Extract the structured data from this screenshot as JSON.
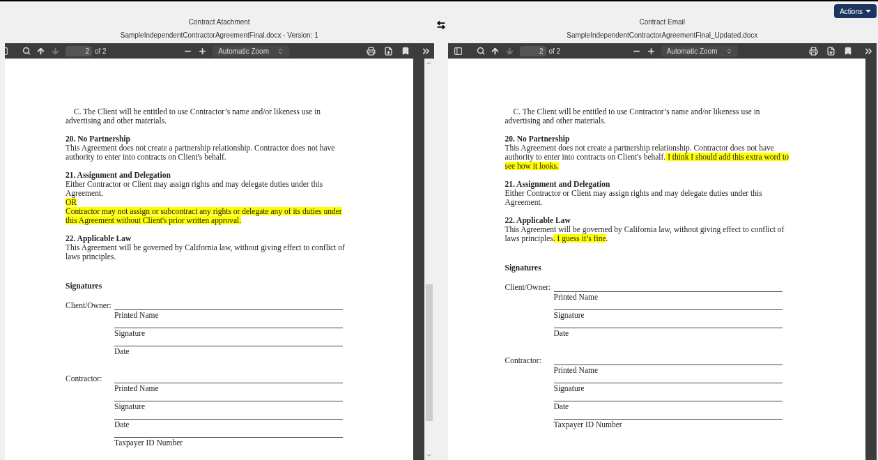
{
  "actions_button": {
    "label": "Actions"
  },
  "panes": [
    {
      "title": "Contract Atachment",
      "subtitle": "SampleIndependentContractorAgreementFinal.docx - Version: 1",
      "toolbar": {
        "page": "2",
        "page_count": "of 2",
        "zoom": "Automatic Zoom"
      },
      "scrollbar": true,
      "sections": [
        {
          "paragraphs": [
            {
              "indent": true,
              "segments": [
                {
                  "text": "C.  The Client will be entitled to use Contractor’s name and/or likeness use in advertising and other materials.",
                  "highlight": false
                }
              ]
            }
          ]
        },
        {
          "heading": "20. No Partnership",
          "paragraphs": [
            {
              "indent": false,
              "segments": [
                {
                  "text": "This Agreement does not create a partnership relationship. Contractor does not have authority to enter into contracts on Client's behalf.",
                  "highlight": false
                }
              ]
            }
          ]
        },
        {
          "heading": "21. Assignment and Delegation",
          "paragraphs": [
            {
              "indent": false,
              "segments": [
                {
                  "text": "Either Contractor or Client may assign rights and may delegate duties under this Agreement.",
                  "highlight": false
                }
              ]
            },
            {
              "indent": false,
              "segments": [
                {
                  "text": "OR",
                  "highlight": true
                }
              ]
            },
            {
              "indent": false,
              "segments": [
                {
                  "text": "Contractor may not assign or subcontract any rights or delegate any of its duties under this Agreement without Client's prior written approval.",
                  "highlight": true
                }
              ]
            }
          ]
        },
        {
          "heading": "22. Applicable Law",
          "paragraphs": [
            {
              "indent": false,
              "segments": [
                {
                  "text": "This Agreement will be governed by California law, without giving effect to conflict of laws principles.",
                  "highlight": false
                }
              ]
            }
          ]
        }
      ],
      "signatures": {
        "heading": "Signatures",
        "parties": [
          {
            "label": "Client/Owner:",
            "captions": [
              "Printed Name",
              "Signature",
              "Date"
            ]
          },
          {
            "label": "Contractor:",
            "captions": [
              "Printed Name",
              "Signature",
              "Date",
              "Taxpayer ID Number"
            ]
          }
        ]
      }
    },
    {
      "title": "Contract Email",
      "subtitle": "SampleIndependentContractorAgreementFinal_Updated.docx",
      "toolbar": {
        "page": "2",
        "page_count": "of 2",
        "zoom": "Automatic Zoom"
      },
      "scrollbar": false,
      "sections": [
        {
          "paragraphs": [
            {
              "indent": true,
              "segments": [
                {
                  "text": "C.  The Client will be entitled to use Contractor’s name and/or likeness use in advertising and other materials.",
                  "highlight": false
                }
              ]
            }
          ]
        },
        {
          "heading": "20. No Partnership",
          "paragraphs": [
            {
              "indent": false,
              "segments": [
                {
                  "text": "This Agreement does not create a partnership relationship. Contractor does not have authority to enter into contracts on Client's behalf.",
                  "highlight": false
                },
                {
                  "text": " I think I should add this extra word to see how it looks.",
                  "highlight": true
                }
              ]
            }
          ]
        },
        {
          "heading": "21. Assignment and Delegation",
          "paragraphs": [
            {
              "indent": false,
              "segments": [
                {
                  "text": "Either Contractor or Client may assign rights and may delegate duties under this Agreement.",
                  "highlight": false
                }
              ]
            }
          ]
        },
        {
          "heading": "22. Applicable Law",
          "paragraphs": [
            {
              "indent": false,
              "segments": [
                {
                  "text": "This Agreement will be governed by California law, without giving effect to conflict of laws principles",
                  "highlight": false
                },
                {
                  "text": ". I guess it’s fine",
                  "highlight": true
                },
                {
                  "text": ".",
                  "highlight": false
                }
              ]
            }
          ]
        }
      ],
      "signatures": {
        "heading": "Signatures",
        "parties": [
          {
            "label": "Client/Owner:",
            "captions": [
              "Printed Name",
              "Signature",
              "Date"
            ]
          },
          {
            "label": "Contractor:",
            "captions": [
              "Printed Name",
              "Signature",
              "Date",
              "Taxpayer ID Number"
            ]
          }
        ]
      }
    }
  ]
}
